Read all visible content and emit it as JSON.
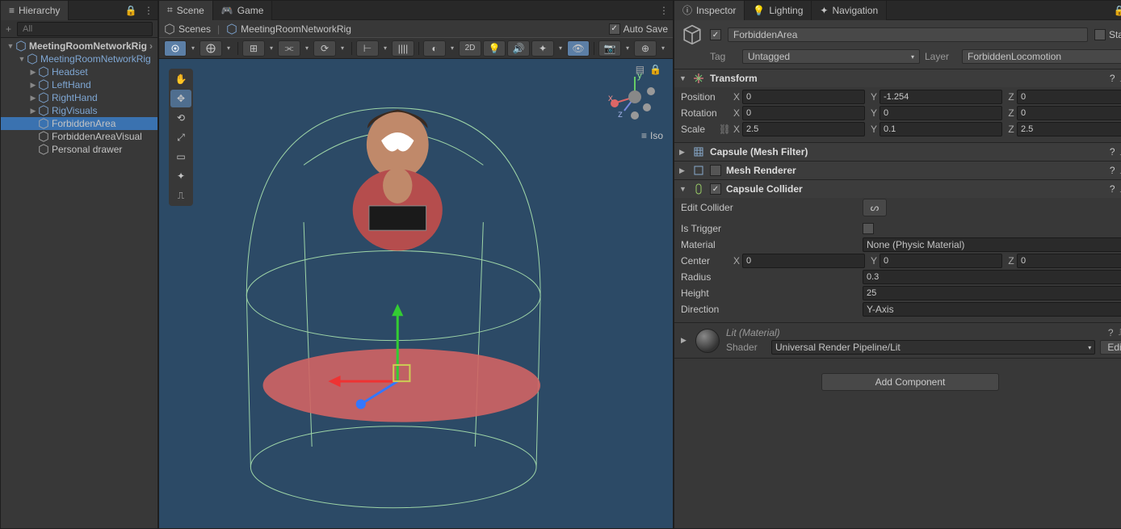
{
  "hierarchy": {
    "title": "Hierarchy",
    "search_placeholder": "All",
    "scene": "MeetingRoomNetworkRig",
    "items": [
      {
        "label": "MeetingRoomNetworkRig",
        "depth": 1,
        "prefab": true,
        "expanded": true
      },
      {
        "label": "Headset",
        "depth": 2,
        "prefab": true,
        "hasChildren": true
      },
      {
        "label": "LeftHand",
        "depth": 2,
        "prefab": true,
        "hasChildren": true
      },
      {
        "label": "RightHand",
        "depth": 2,
        "prefab": true,
        "hasChildren": true
      },
      {
        "label": "RigVisuals",
        "depth": 2,
        "prefab": true,
        "hasChildren": true
      },
      {
        "label": "ForbiddenArea",
        "depth": 2,
        "prefab": false,
        "selected": true
      },
      {
        "label": "ForbiddenAreaVisual",
        "depth": 2,
        "prefab": false
      },
      {
        "label": "Personal drawer",
        "depth": 2,
        "prefab": false
      }
    ]
  },
  "scene": {
    "tab_scene": "Scene",
    "tab_game": "Game",
    "crumb_scenes": "Scenes",
    "crumb_current": "MeetingRoomNetworkRig",
    "auto_save": "Auto Save",
    "twoD": "2D",
    "iso": "Iso"
  },
  "inspector": {
    "tab_inspector": "Inspector",
    "tab_lighting": "Lighting",
    "tab_navigation": "Navigation",
    "go_name": "ForbiddenArea",
    "static": "Static",
    "tag_label": "Tag",
    "tag_value": "Untagged",
    "layer_label": "Layer",
    "layer_value": "ForbiddenLocomotion",
    "transform": {
      "title": "Transform",
      "position_label": "Position",
      "rotation_label": "Rotation",
      "scale_label": "Scale",
      "position": {
        "x": "0",
        "y": "-1.254",
        "z": "0"
      },
      "rotation": {
        "x": "0",
        "y": "0",
        "z": "0"
      },
      "scale": {
        "x": "2.5",
        "y": "0.1",
        "z": "2.5"
      }
    },
    "mesh_filter": {
      "title": "Capsule (Mesh Filter)"
    },
    "mesh_renderer": {
      "title": "Mesh Renderer"
    },
    "capsule_collider": {
      "title": "Capsule Collider",
      "edit_collider": "Edit Collider",
      "is_trigger": "Is Trigger",
      "material": "Material",
      "material_value": "None (Physic Material)",
      "center": "Center",
      "center_v": {
        "x": "0",
        "y": "0",
        "z": "0"
      },
      "radius": "Radius",
      "radius_v": "0.3",
      "height": "Height",
      "height_v": "25",
      "direction": "Direction",
      "direction_v": "Y-Axis"
    },
    "material_section": {
      "name": "Lit (Material)",
      "shader_label": "Shader",
      "shader_value": "Universal Render Pipeline/Lit",
      "edit": "Edit..."
    },
    "add_component": "Add Component"
  }
}
